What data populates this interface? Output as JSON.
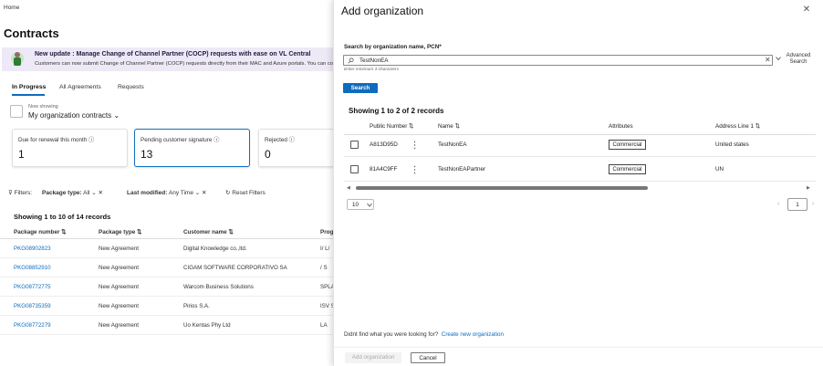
{
  "background": {
    "breadcrumb": "Home",
    "page_title": "Contracts",
    "banner": {
      "title": "New update : Manage Change of Channel Partner (COCP) requests with ease on VL Central",
      "text": "Customers can now submit Change of Channel Partner (COCP) requests directly from their MAC and Azure portals. You can conve"
    },
    "tabs": [
      "In Progress",
      "All Agreements",
      "Requests"
    ],
    "now_showing_label": "Now showing",
    "now_showing_value": "My organization contracts",
    "cards": [
      {
        "label": "Due for renewal this month",
        "value": "1"
      },
      {
        "label": "Pending customer signature",
        "value": "13"
      },
      {
        "label": "Rejected",
        "value": "0"
      }
    ],
    "filters": {
      "label": "Filters:",
      "package_type_label": "Package type:",
      "package_type_value": "All",
      "last_modified_label": "Last modified:",
      "last_modified_value": "Any Time",
      "reset": "Reset Filters"
    },
    "records": "Showing 1 to 10 of 14 records",
    "columns": [
      "Package number",
      "Package type",
      "Customer name",
      "Prog"
    ],
    "rows": [
      {
        "package": "PKG08902823",
        "type": "New Agreement",
        "customer": "Digital Knowledge co.,ltd.",
        "prog": "I/ L/"
      },
      {
        "package": "PKG08852910",
        "type": "New Agreement",
        "customer": "CIGAM SOFTWARE CORPORATIVO SA",
        "prog": "/ S"
      },
      {
        "package": "PKG08772775",
        "type": "New Agreement",
        "customer": "Warcom Business Solutions",
        "prog": "SPLA"
      },
      {
        "package": "PKG08735359",
        "type": "New Agreement",
        "customer": "Pirios S.A.",
        "prog": "ISV S"
      },
      {
        "package": "PKG08772279",
        "type": "New Agreement",
        "customer": "Uo Kentas Phy Ltd",
        "prog": "LA"
      }
    ]
  },
  "panel": {
    "title": "Add organization",
    "search_label": "Search by organization name, PCN*",
    "search_value": "TestNonEA",
    "hint": "Enter minimum 3 characters",
    "advanced_search": "Advanced Search",
    "search_button": "Search",
    "records": "Showing 1 to 2 of 2 records",
    "columns": {
      "public_number": "Public Number",
      "name": "Name",
      "attributes": "Attributes",
      "address": "Address Line 1"
    },
    "rows": [
      {
        "public_number": "A813D95D",
        "name": "TestNonEA",
        "attribute": "Commercial",
        "address": "United states"
      },
      {
        "public_number": "81A4C9FF",
        "name": "TestNonEAPartner",
        "attribute": "Commercial",
        "address": "UN"
      }
    ],
    "page_size": "10",
    "current_page": "1",
    "not_found_text": "Didnt find what you were looking for?",
    "create_link": "Create new organization",
    "add_button": "Add organization",
    "cancel_button": "Cancel"
  },
  "colors": {
    "accent": "#0f6cbd",
    "banner_bg": "#eee9f6"
  }
}
